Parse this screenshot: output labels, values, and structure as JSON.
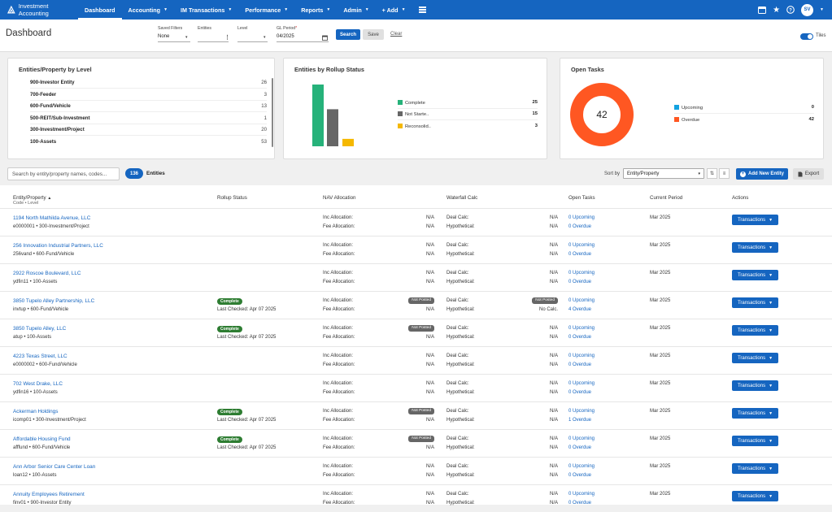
{
  "nav": {
    "brand": "Investment Accounting",
    "items": [
      {
        "label": "Dashboard",
        "caret": false
      },
      {
        "label": "Accounting",
        "caret": true
      },
      {
        "label": "IM Transactions",
        "caret": true
      },
      {
        "label": "Performance",
        "caret": true
      },
      {
        "label": "Reports",
        "caret": true
      },
      {
        "label": "Admin",
        "caret": true
      },
      {
        "label": "+ Add",
        "caret": true
      }
    ],
    "user_initials": "SV",
    "icons": [
      "grid-icon",
      "window-icon",
      "star-icon",
      "help-icon",
      "chevron-down-icon"
    ]
  },
  "header": {
    "title": "Dashboard",
    "filters": {
      "saved_filters_label": "Saved Filters",
      "saved_filters_value": "None",
      "entities_label": "Entities",
      "level_label": "Level",
      "gl_period_label": "GL Period",
      "gl_period_required": "*",
      "gl_period_value": "04/2025"
    },
    "search_label": "Search",
    "save_label": "Save",
    "clear_label": "Clear",
    "tiles_label": "Tiles"
  },
  "cards": {
    "levels": {
      "title": "Entities/Property by Level",
      "rows": [
        {
          "label": "900-Investor Entity",
          "count": "26"
        },
        {
          "label": "700-Feeder",
          "count": "3"
        },
        {
          "label": "600-Fund/Vehicle",
          "count": "13"
        },
        {
          "label": "500-REIT/Sub-Investment",
          "count": "1"
        },
        {
          "label": "300-Investment/Project",
          "count": "20"
        },
        {
          "label": "100-Assets",
          "count": "53"
        }
      ]
    },
    "rollup": {
      "title": "Entities by Rollup Status",
      "legend": [
        {
          "label": "Complete",
          "count": "25",
          "color": "#26b27a"
        },
        {
          "label": "Not Starte..",
          "count": "15",
          "color": "#666666"
        },
        {
          "label": "Reconsolid..",
          "count": "3",
          "color": "#f5b800"
        }
      ]
    },
    "tasks": {
      "title": "Open Tasks",
      "total": "42",
      "legend": [
        {
          "label": "Upcoming",
          "count": "0",
          "color": "#13a2e0"
        },
        {
          "label": "Overdue",
          "count": "42",
          "color": "#ff5722"
        }
      ]
    }
  },
  "chart_data": [
    {
      "type": "bar",
      "categories": [
        "Complete",
        "Not Starte..",
        "Reconsolid.."
      ],
      "values": [
        25,
        15,
        3
      ],
      "title": "Entities by Rollup Status",
      "colors": [
        "#26b27a",
        "#666666",
        "#f5b800"
      ]
    },
    {
      "type": "pie",
      "categories": [
        "Upcoming",
        "Overdue"
      ],
      "values": [
        0,
        42
      ],
      "title": "Open Tasks",
      "colors": [
        "#13a2e0",
        "#ff5722"
      ]
    }
  ],
  "toolbar": {
    "search_placeholder": "Search by entity/property names, codes...",
    "entity_count": "136",
    "entities_label": "Entities",
    "sort_by_label": "Sort by",
    "sort_value": "Entity/Property",
    "add_label": "Add New Entity",
    "export_label": "Export"
  },
  "table": {
    "headers": {
      "entity": "Entity/Property",
      "entity_sub": "Code • Level",
      "rollup": "Rollup Status",
      "nav": "NAV Allocation",
      "waterfall": "Waterfall Calc",
      "tasks": "Open Tasks",
      "period": "Current Period",
      "actions": "Actions"
    },
    "labels": {
      "inc": "Inc Allocation:",
      "fee": "Fee Allocation:",
      "deal": "Deal Calc:",
      "hypo": "Hypothetical:",
      "last_checked_prefix": "Last Checked:"
    },
    "rows": [
      {
        "name": "1194 North Mathilda Avenue, LLC",
        "sub": "e0000001 • 300-Investment/Project",
        "status": "",
        "last_checked": "",
        "inc": "N/A",
        "fee": "N/A",
        "nav_badge": "",
        "deal": "N/A",
        "hypo": "N/A",
        "wf_badge": "",
        "upcoming": "0 Upcoming",
        "overdue": "0 Overdue",
        "period": "Mar 2025",
        "action": "Transactions"
      },
      {
        "name": "256 Innovation Industrial Partners, LLC",
        "sub": "256vand • 600-Fund/Vehicle",
        "status": "",
        "last_checked": "",
        "inc": "N/A",
        "fee": "N/A",
        "nav_badge": "",
        "deal": "N/A",
        "hypo": "N/A",
        "wf_badge": "",
        "upcoming": "0 Upcoming",
        "overdue": "0 Overdue",
        "period": "Mar 2025",
        "action": "Transactions"
      },
      {
        "name": "2922 Roscoe Boulevard, LLC",
        "sub": "ydfin11 • 100-Assets",
        "status": "",
        "last_checked": "",
        "inc": "N/A",
        "fee": "N/A",
        "nav_badge": "",
        "deal": "N/A",
        "hypo": "N/A",
        "wf_badge": "",
        "upcoming": "0 Upcoming",
        "overdue": "0 Overdue",
        "period": "Mar 2025",
        "action": "Transactions"
      },
      {
        "name": "3850 Tupelo Alley Partnership, LLC",
        "sub": "invtup • 600-Fund/Vehicle",
        "status": "Complete",
        "last_checked": "Last Checked: Apr 07 2025",
        "inc": "",
        "fee": "N/A",
        "nav_badge": "Not Posted",
        "deal": "",
        "hypo": "No Calc.",
        "wf_badge": "Not Posted",
        "upcoming": "0 Upcoming",
        "overdue": "4 Overdue",
        "period": "Mar 2025",
        "action": "Transactions"
      },
      {
        "name": "3850 Tupelo Alley, LLC",
        "sub": "atup • 100-Assets",
        "status": "Complete",
        "last_checked": "Last Checked: Apr 07 2025",
        "inc": "",
        "fee": "N/A",
        "nav_badge": "Not Posted",
        "deal": "N/A",
        "hypo": "N/A",
        "wf_badge": "",
        "upcoming": "0 Upcoming",
        "overdue": "0 Overdue",
        "period": "Mar 2025",
        "action": "Transactions"
      },
      {
        "name": "4223 Texas Street, LLC",
        "sub": "e0000002 • 600-Fund/Vehicle",
        "status": "",
        "last_checked": "",
        "inc": "N/A",
        "fee": "N/A",
        "nav_badge": "",
        "deal": "N/A",
        "hypo": "N/A",
        "wf_badge": "",
        "upcoming": "0 Upcoming",
        "overdue": "0 Overdue",
        "period": "Mar 2025",
        "action": "Transactions"
      },
      {
        "name": "702 West Drake, LLC",
        "sub": "ydfin16 • 100-Assets",
        "status": "",
        "last_checked": "",
        "inc": "N/A",
        "fee": "N/A",
        "nav_badge": "",
        "deal": "N/A",
        "hypo": "N/A",
        "wf_badge": "",
        "upcoming": "0 Upcoming",
        "overdue": "0 Overdue",
        "period": "Mar 2025",
        "action": "Transactions"
      },
      {
        "name": "Ackerman Holdings",
        "sub": "icomp01 • 300-Investment/Project",
        "status": "Complete",
        "last_checked": "Last Checked: Apr 07 2025",
        "inc": "",
        "fee": "N/A",
        "nav_badge": "Not Posted",
        "deal": "N/A",
        "hypo": "N/A",
        "wf_badge": "",
        "upcoming": "0 Upcoming",
        "overdue": "1 Overdue",
        "period": "Mar 2025",
        "action": "Transactions"
      },
      {
        "name": "Affordable Housing Fund",
        "sub": "afffund • 600-Fund/Vehicle",
        "status": "Complete",
        "last_checked": "Last Checked: Apr 07 2025",
        "inc": "",
        "fee": "N/A",
        "nav_badge": "Not Posted",
        "deal": "N/A",
        "hypo": "N/A",
        "wf_badge": "",
        "upcoming": "0 Upcoming",
        "overdue": "0 Overdue",
        "period": "Mar 2025",
        "action": "Transactions"
      },
      {
        "name": "Ann Arbor Senior Care Center Loan",
        "sub": "loan12 • 100-Assets",
        "status": "",
        "last_checked": "",
        "inc": "N/A",
        "fee": "N/A",
        "nav_badge": "",
        "deal": "N/A",
        "hypo": "N/A",
        "wf_badge": "",
        "upcoming": "0 Upcoming",
        "overdue": "0 Overdue",
        "period": "Mar 2025",
        "action": "Transactions"
      },
      {
        "name": "Annuity Employees Retirement",
        "sub": "finv01 • 900-Investor Entity",
        "status": "",
        "last_checked": "",
        "inc": "N/A",
        "fee": "N/A",
        "nav_badge": "",
        "deal": "N/A",
        "hypo": "N/A",
        "wf_badge": "",
        "upcoming": "0 Upcoming",
        "overdue": "0 Overdue",
        "period": "Mar 2025",
        "action": "Transactions"
      }
    ]
  }
}
